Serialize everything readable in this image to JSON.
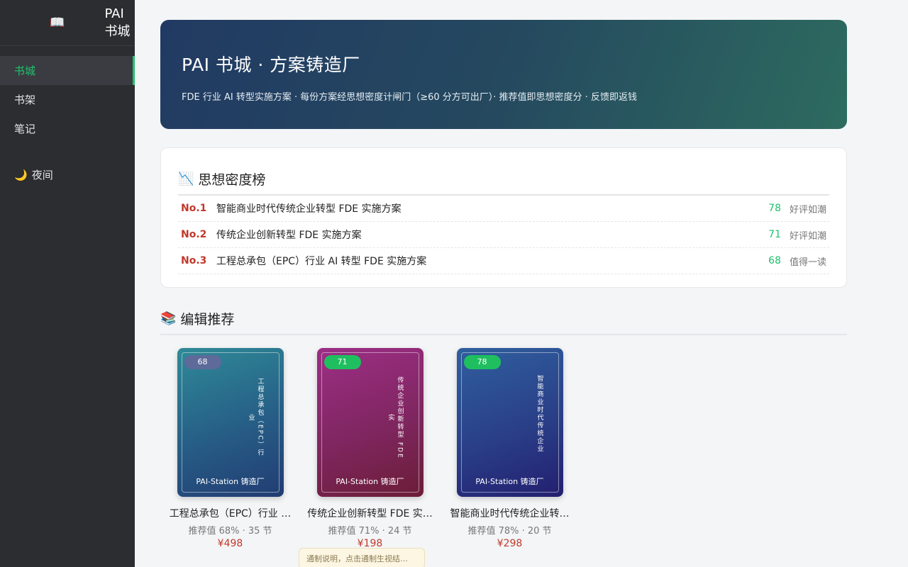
{
  "sidebar": {
    "brand_icon": "open-book-icon",
    "brand": "PAI 书城",
    "items": [
      {
        "label": "书城",
        "active": true
      },
      {
        "label": "书架",
        "active": false
      },
      {
        "label": "笔记",
        "active": false
      }
    ],
    "night_icon": "moon-icon",
    "night_label": "夜间"
  },
  "hero": {
    "title": "PAI 书城 · 方案铸造厂",
    "subtitle": "FDE 行业 AI 转型实施方案 · 每份方案经思想密度计闸门（≥60 分方可出厂）· 推荐值即思想密度分 · 反馈即返钱"
  },
  "ranking": {
    "icon": "chart-down-icon",
    "title": "思想密度榜",
    "rows": [
      {
        "no": "No.1",
        "title": "智能商业时代传统企业转型 FDE 实施方案",
        "score": "78",
        "tag": "好评如潮"
      },
      {
        "no": "No.2",
        "title": "传统企业创新转型 FDE 实施方案",
        "score": "71",
        "tag": "好评如潮"
      },
      {
        "no": "No.3",
        "title": "工程总承包（EPC）行业 AI 转型 FDE 实施方案",
        "score": "68",
        "tag": "值得一读"
      }
    ]
  },
  "recommend": {
    "icon": "books-icon",
    "title": "编辑推荐",
    "books": [
      {
        "score": "68",
        "score_color": "#5e6a9a",
        "cover_text": "工程总承包（EPC）行业",
        "publisher": "PAI-Station 铸造厂",
        "name": "工程总承包（EPC）行业 …",
        "meta": "推荐值 68% · 35 节",
        "price": "¥498"
      },
      {
        "score": "71",
        "score_color": "#1fbf5f",
        "cover_text": "传统企业创新转型 FDE 实",
        "publisher": "PAI-Station 铸造厂",
        "name": "传统企业创新转型 FDE 实…",
        "meta": "推荐值 71% · 24 节",
        "price": "¥198"
      },
      {
        "score": "78",
        "score_color": "#1fbf5f",
        "cover_text": "智能商业时代传统企业",
        "publisher": "PAI-Station 铸造厂",
        "name": "智能商业时代传统企业转…",
        "meta": "推荐值 78% · 20 节",
        "price": "¥298"
      }
    ],
    "tooltip": "通制说明，点击通制生视结…"
  }
}
